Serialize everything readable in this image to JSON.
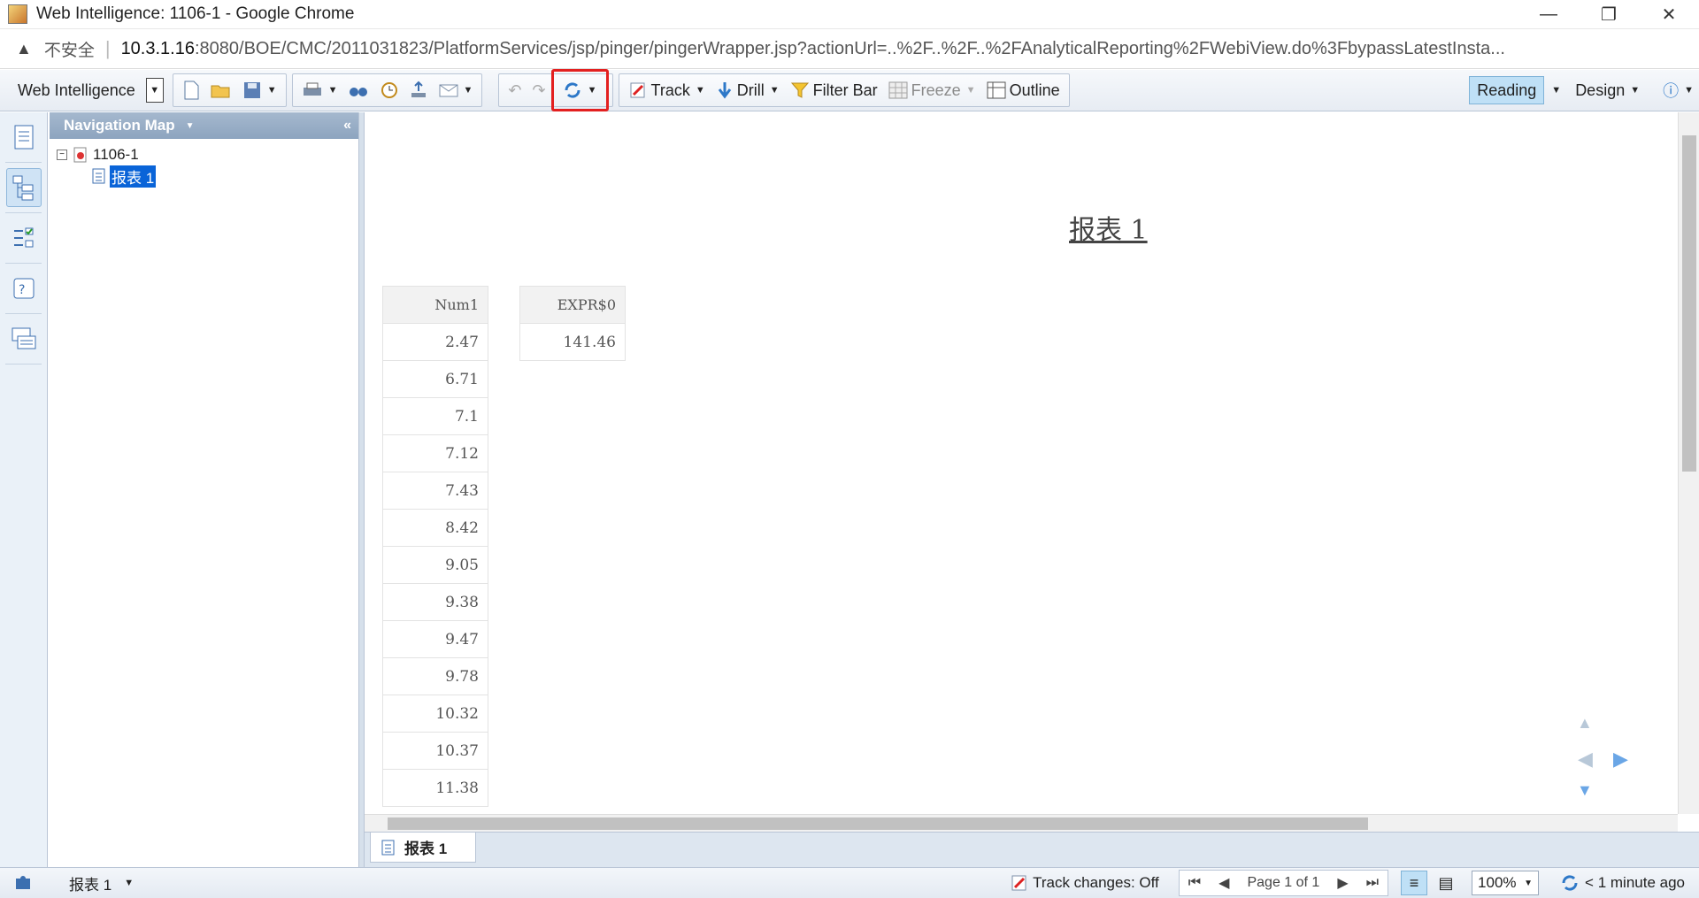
{
  "window": {
    "title": "Web Intelligence: 1106-1 - Google Chrome",
    "controls": [
      "—",
      "❐",
      "✕"
    ]
  },
  "address": {
    "security_label": "不安全",
    "url_host": "10.3.1.16",
    "url_rest": ":8080/BOE/CMC/2011031823/PlatformServices/jsp/pinger/pingerWrapper.jsp?actionUrl=..%2F..%2F..%2FAnalyticalReporting%2FWebiView.do%3FbypassLatestInsta..."
  },
  "toolbar": {
    "app_label": "Web Intelligence",
    "track_label": "Track",
    "drill_label": "Drill",
    "filter_bar_label": "Filter Bar",
    "freeze_label": "Freeze",
    "outline_label": "Outline",
    "reading_label": "Reading",
    "design_label": "Design"
  },
  "nav_panel": {
    "title": "Navigation Map",
    "doc_name": "1106-1",
    "report_name": "报表 1"
  },
  "report": {
    "title": "报表 1",
    "table1": {
      "header": "Num1",
      "values": [
        "2.47",
        "6.71",
        "7.1",
        "7.12",
        "7.43",
        "8.42",
        "9.05",
        "9.38",
        "9.47",
        "9.78",
        "10.32",
        "10.37",
        "11.38"
      ]
    },
    "table2": {
      "header": "EXPR$0",
      "values": [
        "141.46"
      ]
    }
  },
  "tabs": [
    "报表 1"
  ],
  "status": {
    "report_selector": "报表 1",
    "track_changes": "Track changes: Off",
    "page_label": "Page 1 of 1",
    "zoom": "100%",
    "refresh_time": "< 1 minute ago"
  },
  "colors": {
    "toolbar_bg": "#e7ecf3",
    "nav_header": "#8da4bf",
    "selection": "#0a64d8",
    "highlight_box": "#e32020"
  }
}
